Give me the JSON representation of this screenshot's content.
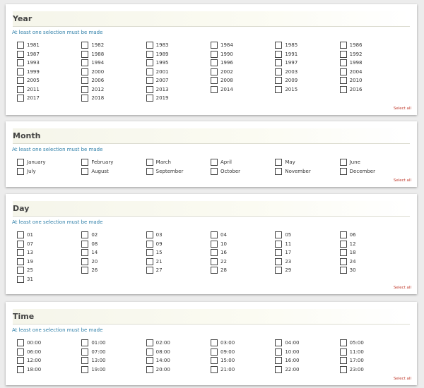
{
  "sections": [
    {
      "title": "Year",
      "hint": "At least one selection must be made",
      "select_all": "Select all",
      "options": [
        "1981",
        "1982",
        "1983",
        "1984",
        "1985",
        "1986",
        "1987",
        "1988",
        "1989",
        "1990",
        "1991",
        "1992",
        "1993",
        "1994",
        "1995",
        "1996",
        "1997",
        "1998",
        "1999",
        "2000",
        "2001",
        "2002",
        "2003",
        "2004",
        "2005",
        "2006",
        "2007",
        "2008",
        "2009",
        "2010",
        "2011",
        "2012",
        "2013",
        "2014",
        "2015",
        "2016",
        "2017",
        "2018",
        "2019"
      ]
    },
    {
      "title": "Month",
      "hint": "At least one selection must be made",
      "select_all": "Select all",
      "options": [
        "January",
        "February",
        "March",
        "April",
        "May",
        "June",
        "July",
        "August",
        "September",
        "October",
        "November",
        "December"
      ]
    },
    {
      "title": "Day",
      "hint": "At least one selection must be made",
      "select_all": "Select all",
      "options": [
        "01",
        "02",
        "03",
        "04",
        "05",
        "06",
        "07",
        "08",
        "09",
        "10",
        "11",
        "12",
        "13",
        "14",
        "15",
        "16",
        "17",
        "18",
        "19",
        "20",
        "21",
        "22",
        "23",
        "24",
        "25",
        "26",
        "27",
        "28",
        "29",
        "30",
        "31"
      ]
    },
    {
      "title": "Time",
      "hint": "At least one selection must be made",
      "select_all": "Select all",
      "options": [
        "00:00",
        "01:00",
        "02:00",
        "03:00",
        "04:00",
        "05:00",
        "06:00",
        "07:00",
        "08:00",
        "09:00",
        "10:00",
        "11:00",
        "12:00",
        "13:00",
        "14:00",
        "15:00",
        "16:00",
        "17:00",
        "18:00",
        "19:00",
        "20:00",
        "21:00",
        "22:00",
        "23:00"
      ]
    }
  ]
}
